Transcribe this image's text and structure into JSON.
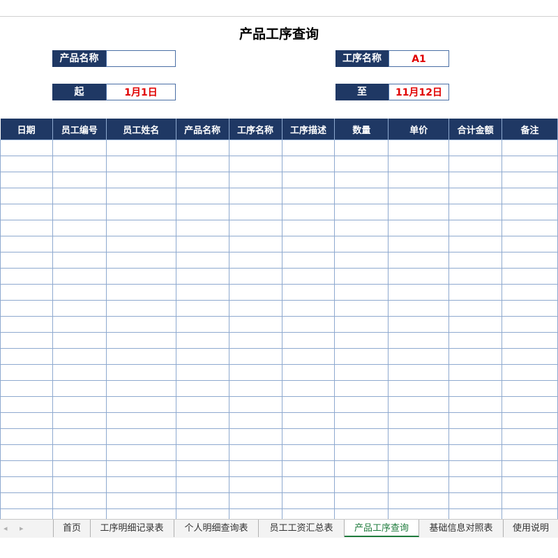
{
  "title": "产品工序查询",
  "filters": {
    "product_name_label": "产品名称",
    "product_name_value": "",
    "process_name_label": "工序名称",
    "process_name_value": "A1",
    "start_label": "起",
    "start_value": "1月1日",
    "end_label": "至",
    "end_value": "11月12日"
  },
  "table": {
    "headers": [
      "日期",
      "员工编号",
      "员工姓名",
      "产品名称",
      "工序名称",
      "工序描述",
      "数量",
      "单价",
      "合计金额",
      "备注"
    ]
  },
  "sheet_tabs": {
    "prev": "◂",
    "next": "▸",
    "tabs": [
      "首页",
      "工序明细记录表",
      "个人明细查询表",
      "员工工资汇总表",
      "产品工序查询",
      "基础信息对照表",
      "使用说明"
    ],
    "active": "产品工序查询"
  },
  "colors": {
    "header_bg": "#1f3864",
    "value_red": "#e00000",
    "active_tab": "#1e7b3c"
  }
}
